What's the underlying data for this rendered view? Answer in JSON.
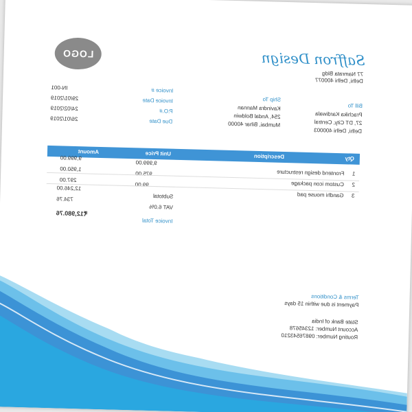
{
  "company": {
    "name": "Saffron Design",
    "address_line1": "77 Namrata Bldg",
    "address_line2": "Delhi, Delhi 400077"
  },
  "logo_text": "LOGO",
  "bill_to": {
    "label": "Bill To",
    "lines": [
      "Prachika Kardiwala",
      "27, DT City, Central",
      "Delhi, Delhi 400003"
    ]
  },
  "ship_to": {
    "label": "Ship To",
    "lines": [
      "Kavindra Mannan",
      "254, Andal Boldwin",
      "Mumbai, Bihar 40000"
    ]
  },
  "invoice_meta": [
    {
      "label": "Invoice #",
      "value": "IN-001"
    },
    {
      "label": "Invoice Date",
      "value": "29/01/2019"
    },
    {
      "label": "P.O.#",
      "value": "24/02/2019"
    },
    {
      "label": "Due Date",
      "value": "26/01/2019"
    }
  ],
  "table": {
    "headers": {
      "qty": "Qty",
      "description": "Description",
      "unit_price": "Unit Price",
      "amount": "Amount"
    },
    "rows": [
      {
        "qty": "1",
        "description": "Frontend design restructure",
        "unit_price": "9,999.00",
        "amount": "9,999.00"
      },
      {
        "qty": "2",
        "description": "Custom icon package",
        "unit_price": "975.00",
        "amount": "1,950.00"
      },
      {
        "qty": "3",
        "description": "Gandhi mouse pad",
        "unit_price": "99.00",
        "amount": "297.00"
      }
    ]
  },
  "totals": {
    "subtotal_label": "Subtotal",
    "subtotal_value": "12,246.00",
    "vat_label": "VAT 6.0%",
    "vat_value": "734.76",
    "total_label": "Invoice Total",
    "total_value": "₹12,980.76"
  },
  "terms": {
    "title": "Terms & Conditions",
    "line1": "Payment is due within 15 days",
    "bank_name": "State Bank of India",
    "account": "Account Number: 12345678",
    "routing": "Routing Number: 09876543210"
  },
  "colors": {
    "accent": "#2f8fc8",
    "header_bar": "#3f94d6",
    "wave_dark": "#3c93d6",
    "wave_light": "#a8dcf2"
  }
}
